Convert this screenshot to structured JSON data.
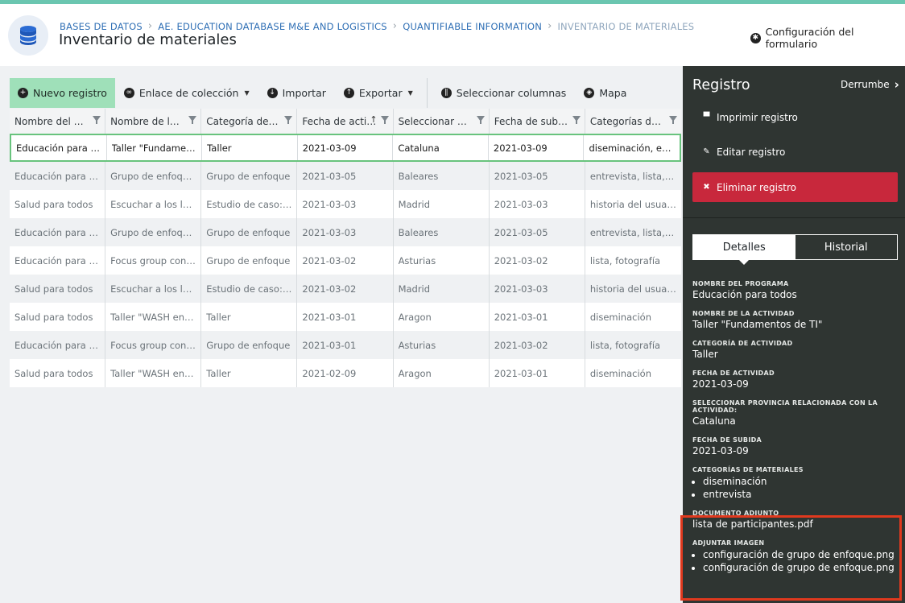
{
  "breadcrumb": [
    "BASES DE DATOS",
    "AE. EDUCATION DATABASE M&E AND LOGISTICS",
    "QUANTIFIABLE INFORMATION",
    "INVENTARIO DE MATERIALES"
  ],
  "page_title": "Inventario de materiales",
  "form_config_label": "Configuración del formulario",
  "toolbar": {
    "new_record": "Nuevo registro",
    "collection_link": "Enlace de colección",
    "import": "Importar",
    "export": "Exportar",
    "select_columns": "Seleccionar columnas",
    "map": "Mapa"
  },
  "table": {
    "columns": [
      "Nombre del pro…",
      "Nombre de la a…",
      "Categoría de ac…",
      "Fecha de acti…",
      "Seleccionar pro…",
      "Fecha de subida",
      "Categorías de …"
    ],
    "rows": [
      [
        "Educación para t…",
        "Taller \"Fundame…",
        "Taller",
        "2021-03-09",
        "Cataluna",
        "2021-03-09",
        "diseminación, en…"
      ],
      [
        "Educación para to…",
        "Grupo de enfoque…",
        "Grupo de enfoque",
        "2021-03-05",
        "Baleares",
        "2021-03-05",
        "entrevista, lista, f…"
      ],
      [
        "Salud para todos",
        "Escuchar a los lug…",
        "Estudio de caso: …",
        "2021-03-03",
        "Madrid",
        "2021-03-03",
        "historia del usuario"
      ],
      [
        "Educación para to…",
        "Grupo de enfoque…",
        "Grupo de enfoque",
        "2021-03-03",
        "Baleares",
        "2021-03-05",
        "entrevista, lista, f…"
      ],
      [
        "Educación para to…",
        "Focus group con …",
        "Grupo de enfoque",
        "2021-03-02",
        "Asturias",
        "2021-03-02",
        "lista, fotografía"
      ],
      [
        "Salud para todos",
        "Escuchar a los lug…",
        "Estudio de caso: …",
        "2021-03-02",
        "Madrid",
        "2021-03-03",
        "historia del usuario"
      ],
      [
        "Salud para todos",
        "Taller \"WASH en l…",
        "Taller",
        "2021-03-01",
        "Aragon",
        "2021-03-01",
        "diseminación"
      ],
      [
        "Educación para to…",
        "Focus group con …",
        "Grupo de enfoque",
        "2021-03-01",
        "Asturias",
        "2021-03-02",
        "lista, fotografía"
      ],
      [
        "Salud para todos",
        "Taller \"WASH en l…",
        "Taller",
        "2021-02-09",
        "Aragon",
        "2021-03-01",
        "diseminación"
      ]
    ]
  },
  "panel": {
    "title": "Registro",
    "collapse_label": "Derrumbe",
    "print": "Imprimir registro",
    "edit": "Editar registro",
    "delete": "Eliminar registro",
    "tab_details": "Detalles",
    "tab_history": "Historial",
    "fields": [
      {
        "label": "NOMBRE DEL PROGRAMA",
        "value": "Educación para todos"
      },
      {
        "label": "NOMBRE DE LA ACTIVIDAD",
        "value": "Taller \"Fundamentos de TI\""
      },
      {
        "label": "CATEGORÍA DE ACTIVIDAD",
        "value": "Taller"
      },
      {
        "label": "FECHA DE ACTIVIDAD",
        "value": "2021-03-09"
      },
      {
        "label": "SELECCIONAR PROVINCIA RELACIONADA CON LA ACTIVIDAD:",
        "value": "Cataluna"
      },
      {
        "label": "FECHA DE SUBIDA",
        "value": "2021-03-09"
      },
      {
        "label": "CATEGORÍAS DE MATERIALES",
        "list": [
          "diseminación",
          "entrevista"
        ]
      },
      {
        "label": "DOCUMENTO ADJUNTO",
        "value": "lista de participantes.pdf"
      },
      {
        "label": "ADJUNTAR IMAGEN",
        "list": [
          "configuración de grupo de enfoque.png",
          "configuración de grupo de enfoque.png"
        ]
      }
    ]
  },
  "colors": {
    "accent_green": "#9fe0b9",
    "selected_border": "#68c37d",
    "panel_bg": "#2f3532",
    "danger": "#c8283c",
    "highlight": "#e0391e",
    "link": "#2f6fb5"
  }
}
